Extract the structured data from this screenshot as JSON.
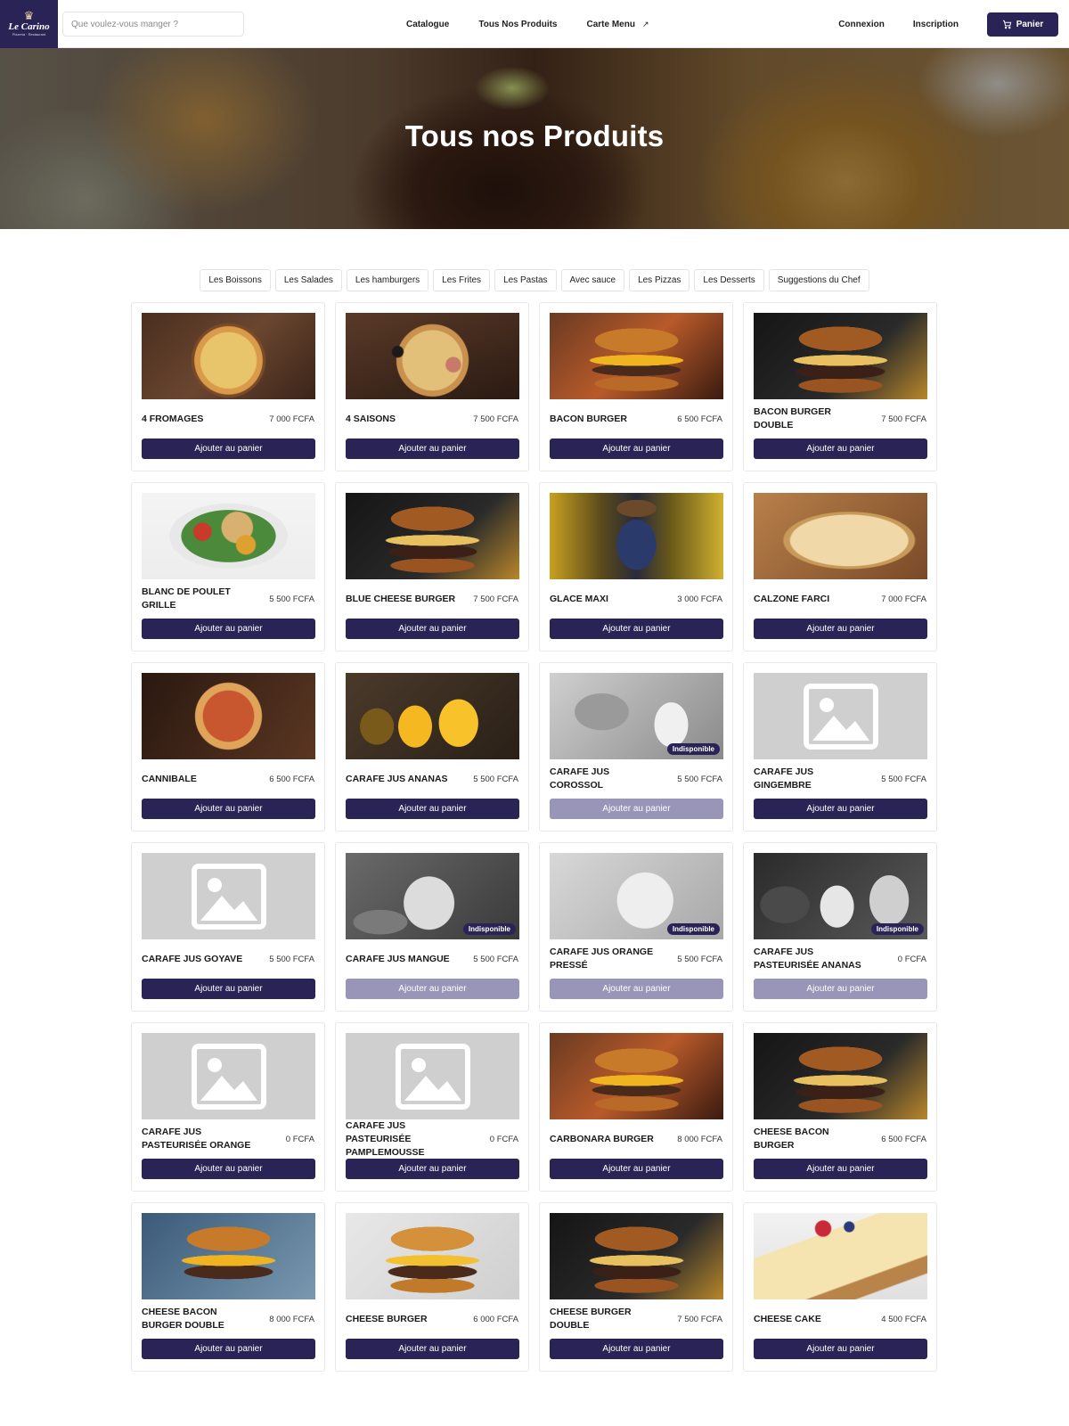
{
  "header": {
    "logo_brand": "Le Carino",
    "logo_tagline": "Pizzeria · Restaurant",
    "search_placeholder": "Que voulez-vous manger ?",
    "nav": [
      "Catalogue",
      "Tous Nos Produits",
      "Carte Menu"
    ],
    "nav_external_icon": "external-link-icon",
    "login": "Connexion",
    "register": "Inscription",
    "cart": "Panier",
    "cart_icon": "cart-icon"
  },
  "hero": {
    "title": "Tous nos Produits"
  },
  "filters": [
    "Les Boissons",
    "Les Salades",
    "Les hamburgers",
    "Les Frites",
    "Les Pastas",
    "Avec sauce",
    "Les Pizzas",
    "Les Desserts",
    "Suggestions du Chef"
  ],
  "colors": {
    "brand": "#2a2456",
    "button_disabled": "#9895b8",
    "placeholder": "#cfcfcf"
  },
  "products": [
    {
      "name": "4 FROMAGES",
      "price": "7 000 FCFA",
      "button": "Ajouter au panier",
      "badge": "",
      "image": "pizza"
    },
    {
      "name": "4 SAISONS",
      "price": "7 500 FCFA",
      "button": "Ajouter au panier",
      "badge": "",
      "image": "pizza two"
    },
    {
      "name": "BACON BURGER",
      "price": "6 500 FCFA",
      "button": "Ajouter au panier",
      "badge": "",
      "image": "burger"
    },
    {
      "name": "BACON BURGER DOUBLE",
      "price": "7 500 FCFA",
      "button": "Ajouter au panier",
      "badge": "",
      "image": "burger dark"
    },
    {
      "name": "BLANC DE POULET GRILLE",
      "price": "5 500 FCFA",
      "button": "Ajouter au panier",
      "badge": "",
      "image": "salad"
    },
    {
      "name": "BLUE CHEESE BURGER",
      "price": "7 500 FCFA",
      "button": "Ajouter au panier",
      "badge": "",
      "image": "burger dark"
    },
    {
      "name": "GLACE MAXI",
      "price": "3 000 FCFA",
      "button": "Ajouter au panier",
      "badge": "",
      "image": "glace"
    },
    {
      "name": "CALZONE FARCI",
      "price": "7 000 FCFA",
      "button": "Ajouter au panier",
      "badge": "",
      "image": "calzone"
    },
    {
      "name": "CANNIBALE",
      "price": "6 500 FCFA",
      "button": "Ajouter au panier",
      "badge": "",
      "image": "pizza three"
    },
    {
      "name": "CARAFE JUS ANANAS",
      "price": "5 500 FCFA",
      "button": "Ajouter au panier",
      "badge": "",
      "image": "juice"
    },
    {
      "name": "CARAFE JUS COROSSOL",
      "price": "5 500 FCFA",
      "button": "Ajouter au panier",
      "badge": "Indisponible",
      "image": "gray1"
    },
    {
      "name": "CARAFE JUS GINGEMBRE",
      "price": "5 500 FCFA",
      "button": "Ajouter au panier",
      "badge": "",
      "image": "placeholder"
    },
    {
      "name": "CARAFE JUS GOYAVE",
      "price": "5 500 FCFA",
      "button": "Ajouter au panier",
      "badge": "",
      "image": "placeholder"
    },
    {
      "name": "CARAFE JUS MANGUE",
      "price": "5 500 FCFA",
      "button": "Ajouter au panier",
      "badge": "Indisponible",
      "image": "gray2"
    },
    {
      "name": "CARAFE JUS ORANGE PRESSÉ",
      "price": "5 500 FCFA",
      "button": "Ajouter au panier",
      "badge": "Indisponible",
      "image": "gray3"
    },
    {
      "name": "CARAFE JUS PASTEURISÉE ANANAS",
      "price": "0 FCFA",
      "button": "Ajouter au panier",
      "badge": "Indisponible",
      "image": "gray4"
    },
    {
      "name": "CARAFE JUS PASTEURISÉE ORANGE",
      "price": "0 FCFA",
      "button": "Ajouter au panier",
      "badge": "",
      "image": "placeholder"
    },
    {
      "name": "CARAFE JUS PASTEURISÉE PAMPLEMOUSSE",
      "price": "0 FCFA",
      "button": "Ajouter au panier",
      "badge": "",
      "image": "placeholder"
    },
    {
      "name": "CARBONARA BURGER",
      "price": "8 000 FCFA",
      "button": "Ajouter au panier",
      "badge": "",
      "image": "burger"
    },
    {
      "name": "CHEESE BACON BURGER",
      "price": "6 500 FCFA",
      "button": "Ajouter au panier",
      "badge": "",
      "image": "burger dark"
    },
    {
      "name": "CHEESE BACON BURGER DOUBLE",
      "price": "8 000 FCFA",
      "button": "Ajouter au panier",
      "badge": "",
      "image": "burger blue"
    },
    {
      "name": "CHEESE BURGER",
      "price": "6 000 FCFA",
      "button": "Ajouter au panier",
      "badge": "",
      "image": "burger light"
    },
    {
      "name": "CHEESE BURGER DOUBLE",
      "price": "7 500 FCFA",
      "button": "Ajouter au panier",
      "badge": "",
      "image": "burger dark"
    },
    {
      "name": "CHEESE CAKE",
      "price": "4 500 FCFA",
      "button": "Ajouter au panier",
      "badge": "",
      "image": "cake"
    }
  ]
}
